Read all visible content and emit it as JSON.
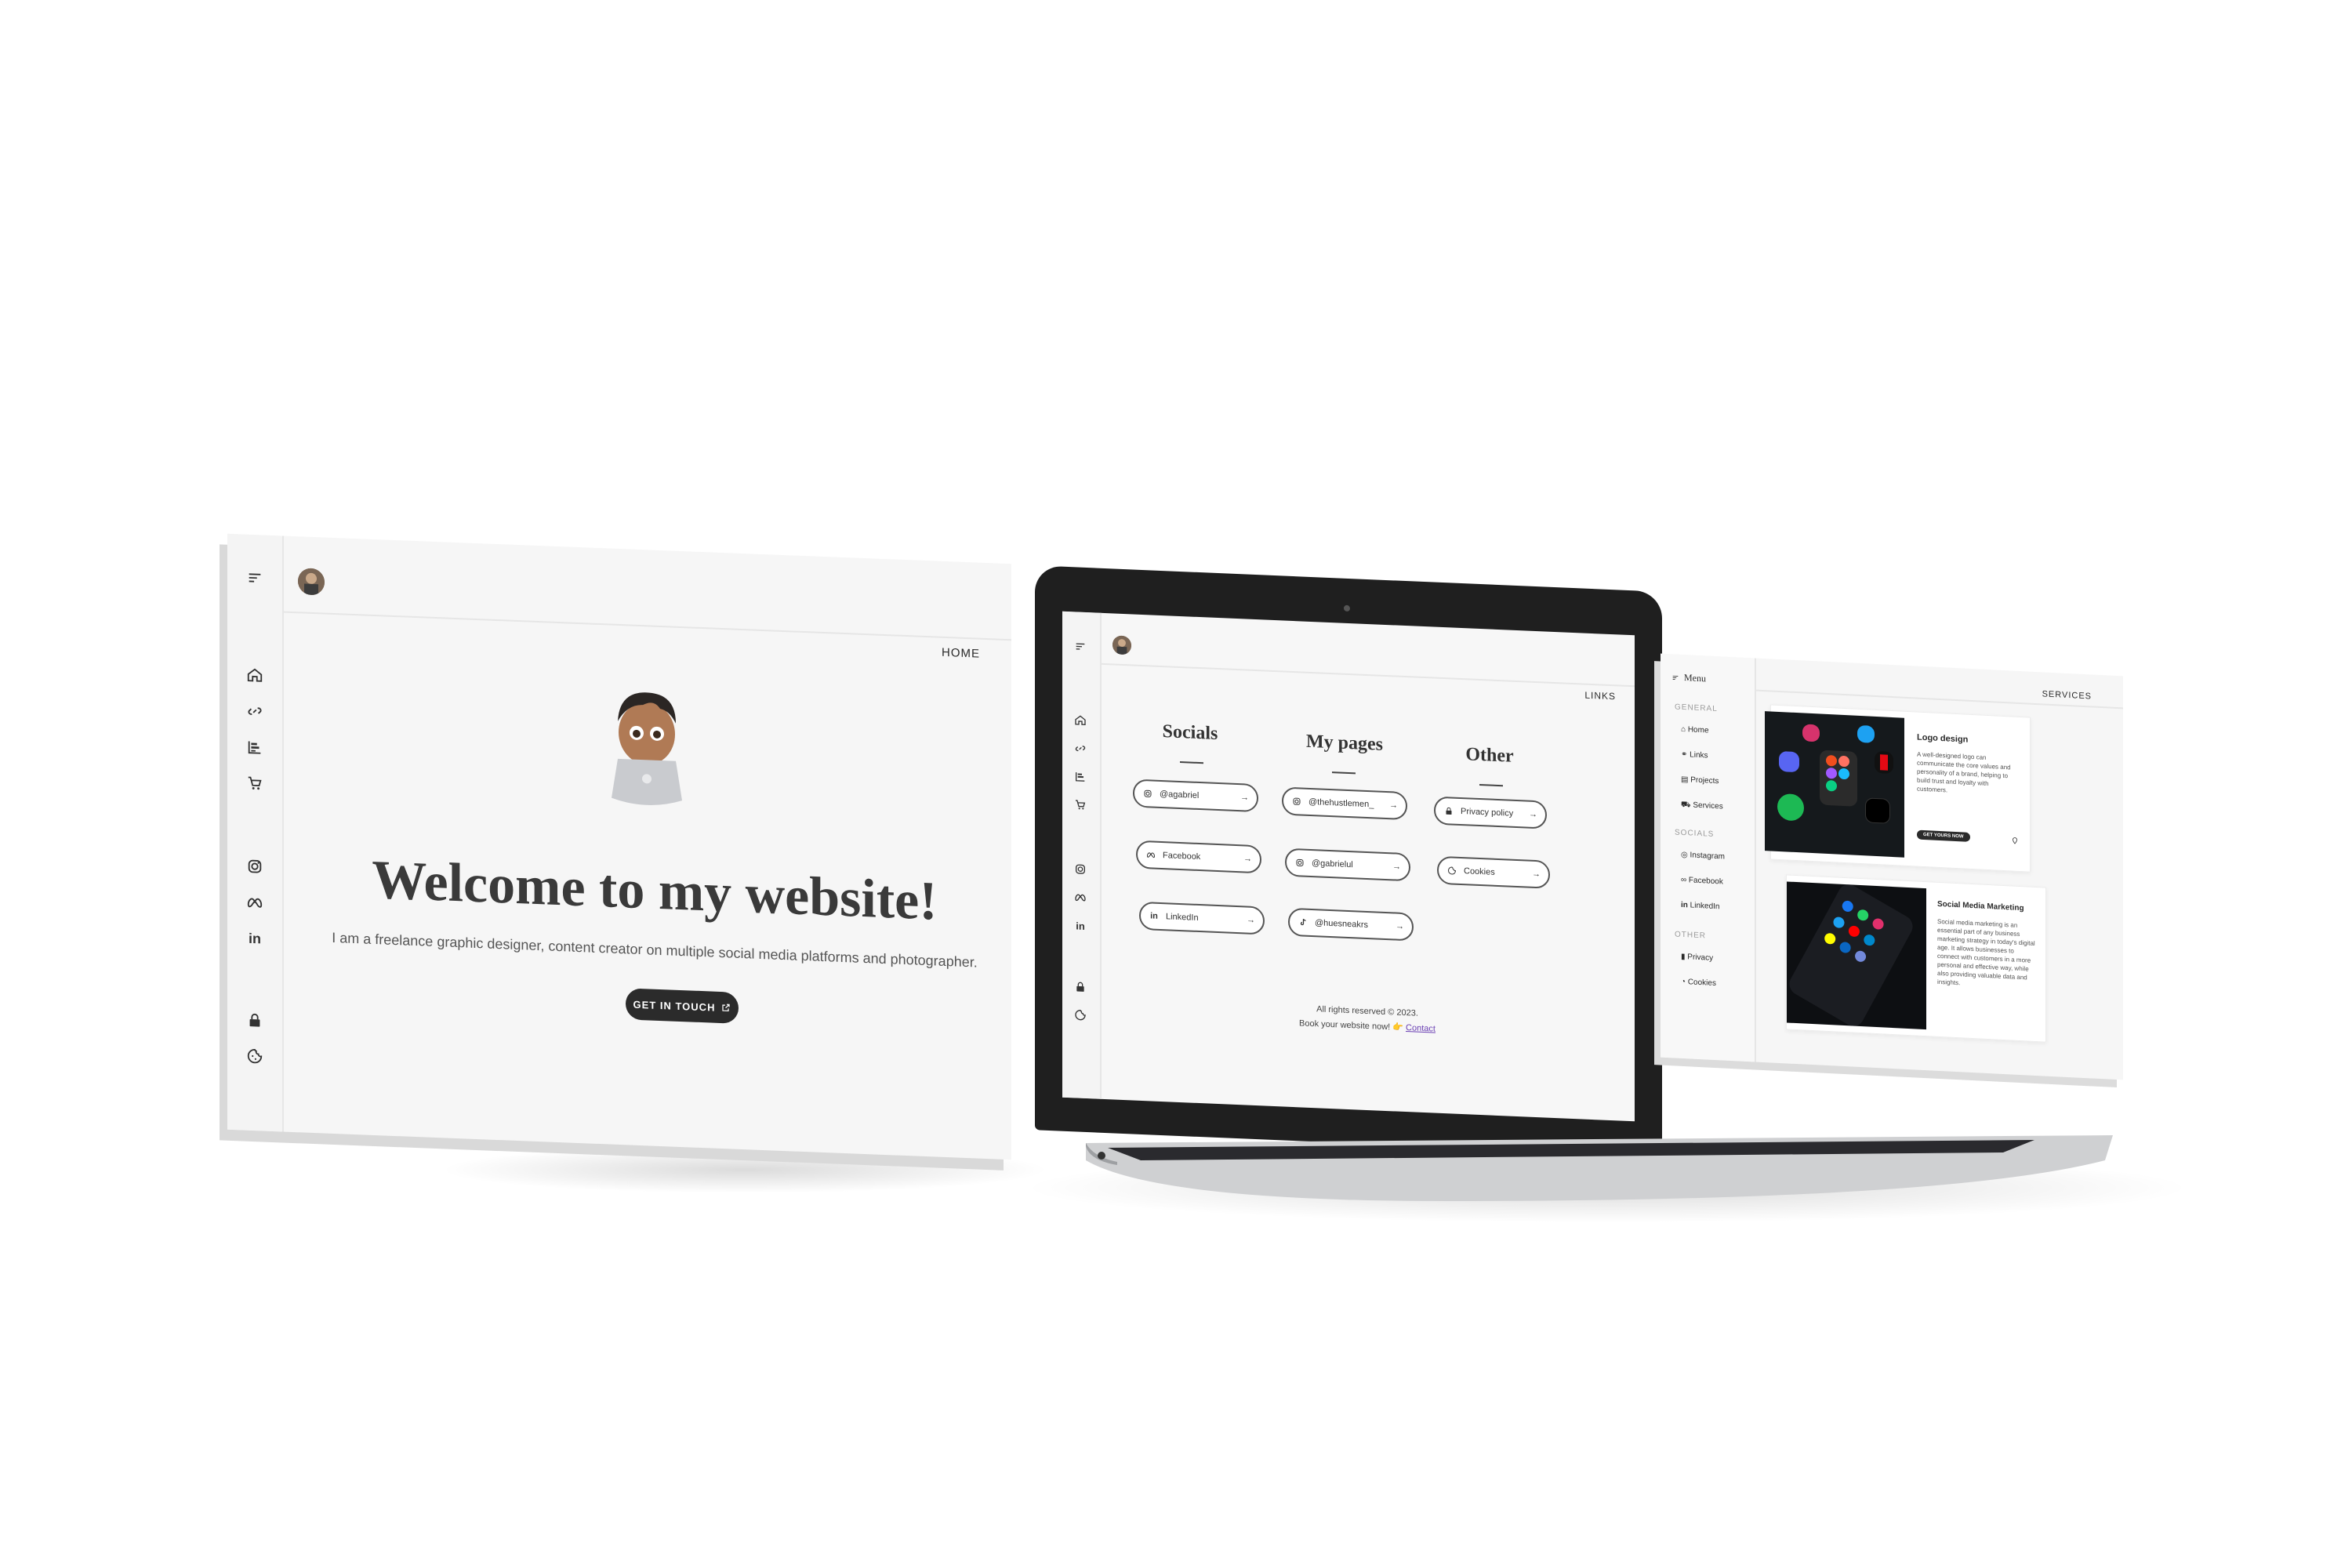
{
  "home": {
    "header_label": "HOME",
    "headline": "Welcome to my website!",
    "subtitle": "I am a freelance graphic designer, content creator on multiple social media platforms and photographer.",
    "cta_label": "GET IN TOUCH",
    "nav_icons": [
      "menu-icon",
      "home-icon",
      "link-icon",
      "projects-icon",
      "cart-icon",
      "instagram-icon",
      "meta-icon",
      "linkedin-icon",
      "lock-icon",
      "cookie-icon"
    ]
  },
  "links": {
    "header_label": "LINKS",
    "columns": [
      {
        "title": "Socials",
        "items": [
          "@agabriel",
          "Facebook",
          "LinkedIn"
        ]
      },
      {
        "title": "My pages",
        "items": [
          "@thehustlemen_",
          "@gabrielul",
          "@huesneakrs"
        ]
      },
      {
        "title": "Other",
        "items": [
          "Privacy policy",
          "Cookies"
        ]
      }
    ],
    "footer_line1": "All rights reserved © 2023.",
    "footer_line2": "Book your website now! 👉",
    "footer_link": "Contact"
  },
  "services": {
    "header_label": "SERVICES",
    "menu_title": "Menu",
    "sections": [
      {
        "title": "GENERAL",
        "items": [
          "Home",
          "Links",
          "Projects",
          "Services"
        ]
      },
      {
        "title": "SOCIALS",
        "items": [
          "Instagram",
          "Facebook",
          "LinkedIn"
        ]
      },
      {
        "title": "OTHER",
        "items": [
          "Privacy",
          "Cookies"
        ]
      }
    ],
    "cards": [
      {
        "title": "Logo design",
        "text": "A well-designed logo can communicate the core values and personality of a brand, helping to build trust and loyalty with customers.",
        "button": "GET YOURS NOW"
      },
      {
        "title": "Social Media Marketing",
        "text": "Social media marketing is an essential part of any business marketing strategy in today's digital age. It allows businesses to connect with customers in a more personal and effective way, while also providing valuable data and insights."
      }
    ]
  },
  "colors": {
    "accent_dark": "#2b2b2b",
    "page_bg": "#f6f6f6",
    "link_purple": "#6a3fb3"
  }
}
